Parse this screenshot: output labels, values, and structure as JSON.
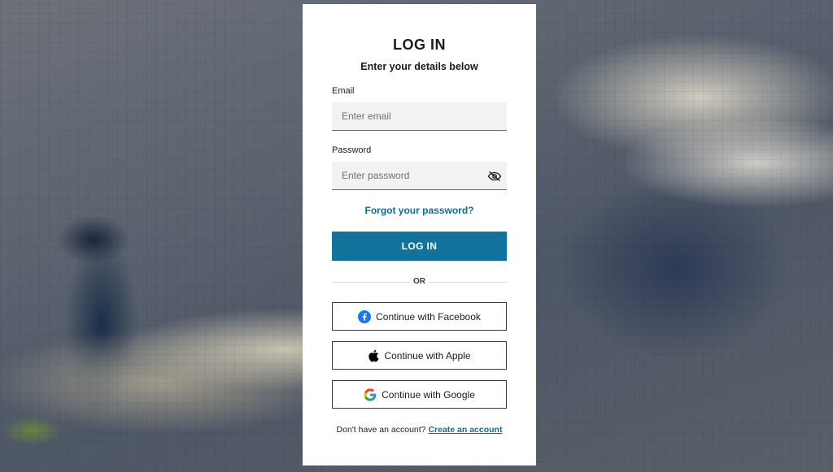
{
  "form": {
    "title": "LOG IN",
    "subtitle": "Enter your details below",
    "email_label": "Email",
    "email_placeholder": "Enter email",
    "email_value": "",
    "password_label": "Password",
    "password_placeholder": "Enter password",
    "password_value": "",
    "forgot_link": "Forgot your password?",
    "login_button": "LOG IN",
    "divider_text": "OR"
  },
  "social": {
    "facebook_label": "Continue with Facebook",
    "apple_label": "Continue with Apple",
    "google_label": "Continue with Google"
  },
  "footer": {
    "prompt": "Don't have an account?",
    "create_link": "Create an account"
  },
  "icons": {
    "password_toggle": "eye-slash-icon",
    "facebook": "facebook-icon",
    "apple": "apple-icon",
    "google": "google-icon"
  },
  "colors": {
    "accent": "#11729c",
    "link": "#0e6f93",
    "facebook": "#1877f2"
  }
}
